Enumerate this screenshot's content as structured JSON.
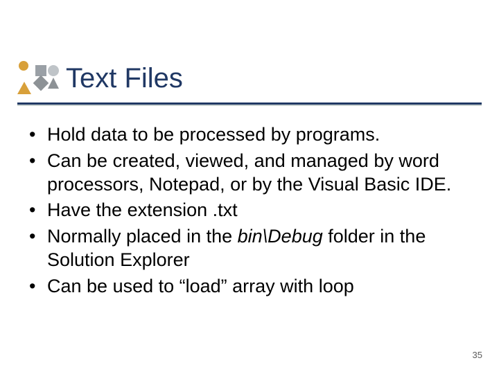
{
  "title": "Text Files",
  "bullets": [
    {
      "text": "Hold data to be processed by programs."
    },
    {
      "text": "Can be created, viewed, and managed by word processors, Notepad, or by the Visual Basic IDE."
    },
    {
      "text": "Have the extension .txt"
    },
    {
      "pre": "Normally placed in the ",
      "em": "bin\\Debug",
      "post": " folder in the Solution Explorer"
    },
    {
      "text": "Can be used to “load” array with loop"
    }
  ],
  "page_number": "35"
}
